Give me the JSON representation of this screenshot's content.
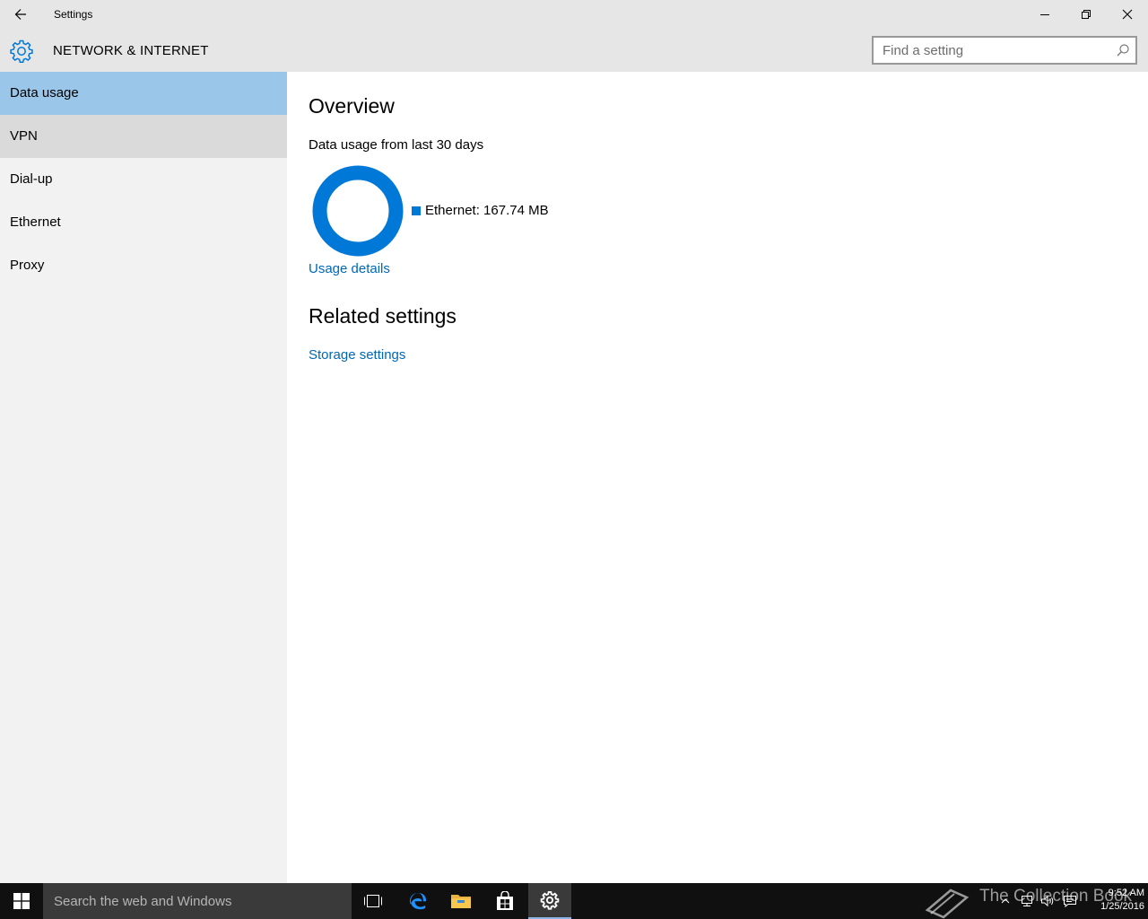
{
  "window": {
    "title": "Settings",
    "back_icon": "back-arrow-icon",
    "controls": [
      "minimize-icon",
      "restore-icon",
      "close-icon"
    ]
  },
  "header": {
    "icon": "gear-icon",
    "title": "NETWORK & INTERNET",
    "search_placeholder": "Find a setting",
    "search_icon": "search-icon"
  },
  "sidebar": {
    "items": [
      {
        "label": "Data usage",
        "state": "selected"
      },
      {
        "label": "VPN",
        "state": "hover"
      },
      {
        "label": "Dial-up",
        "state": "normal"
      },
      {
        "label": "Ethernet",
        "state": "normal"
      },
      {
        "label": "Proxy",
        "state": "normal"
      }
    ]
  },
  "main": {
    "overview_heading": "Overview",
    "usage_caption": "Data usage from last 30 days",
    "usage_legend": "Ethernet: 167.74 MB",
    "usage_details_link": "Usage details",
    "related_heading": "Related settings",
    "storage_link": "Storage settings"
  },
  "chart_data": {
    "type": "pie",
    "categories": [
      "Ethernet"
    ],
    "values": [
      167.74
    ],
    "unit": "MB",
    "colors": [
      "#0078d7"
    ]
  },
  "taskbar": {
    "search_placeholder": "Search the web and Windows",
    "icons": [
      "windows-start-icon",
      "task-view-icon",
      "edge-icon",
      "file-explorer-icon",
      "store-icon",
      "settings-icon"
    ],
    "tray_icons": [
      "chevron-up-icon",
      "network-icon",
      "volume-icon",
      "action-center-icon"
    ],
    "time": "9:52 AM",
    "date": "1/25/2016",
    "watermark": "The Collection Book"
  },
  "colors": {
    "accent": "#0078d7",
    "link": "#0067b8",
    "selected_nav": "#99c6e9",
    "chrome": "#e6e6e6",
    "sidebar": "#f2f2f2",
    "taskbar": "#101010"
  }
}
